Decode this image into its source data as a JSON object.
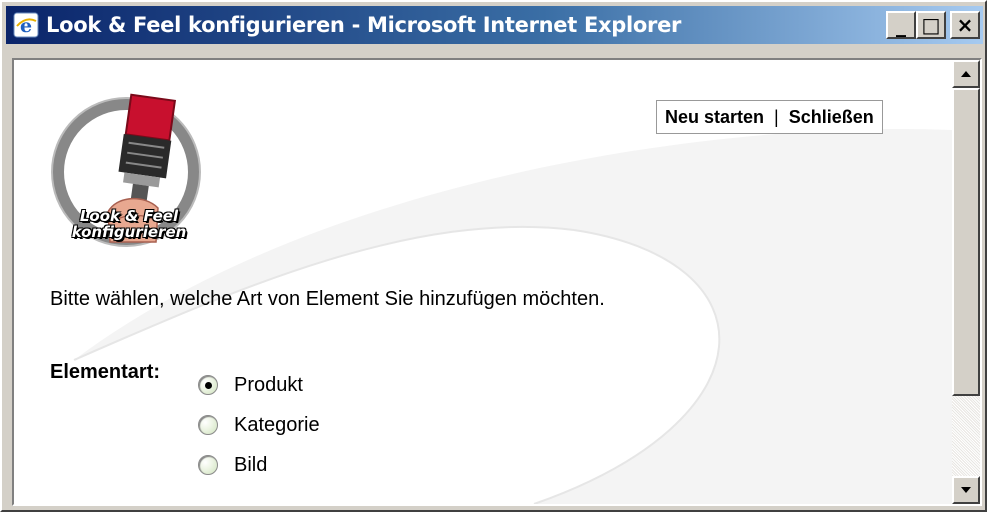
{
  "window": {
    "title": "Look & Feel konfigurieren - Microsoft Internet Explorer",
    "controls": [
      "_",
      "□",
      "×"
    ]
  },
  "logo": {
    "line1": "Look & Feel",
    "line2": "konfigurieren",
    "icon": "paintbrush-icon"
  },
  "links": {
    "restart": "Neu starten",
    "separator": "|",
    "close": "Schließen"
  },
  "instruction": "Bitte wählen, welche Art von Element Sie hinzufügen möchten.",
  "element_type": {
    "label": "Elementart:",
    "options": [
      {
        "label": "Produkt",
        "selected": true
      },
      {
        "label": "Kategorie",
        "selected": false
      },
      {
        "label": "Bild",
        "selected": false
      }
    ]
  },
  "colors": {
    "titlebar_start": "#0a246a",
    "titlebar_end": "#a6caf0",
    "brush_red": "#c8102e"
  }
}
